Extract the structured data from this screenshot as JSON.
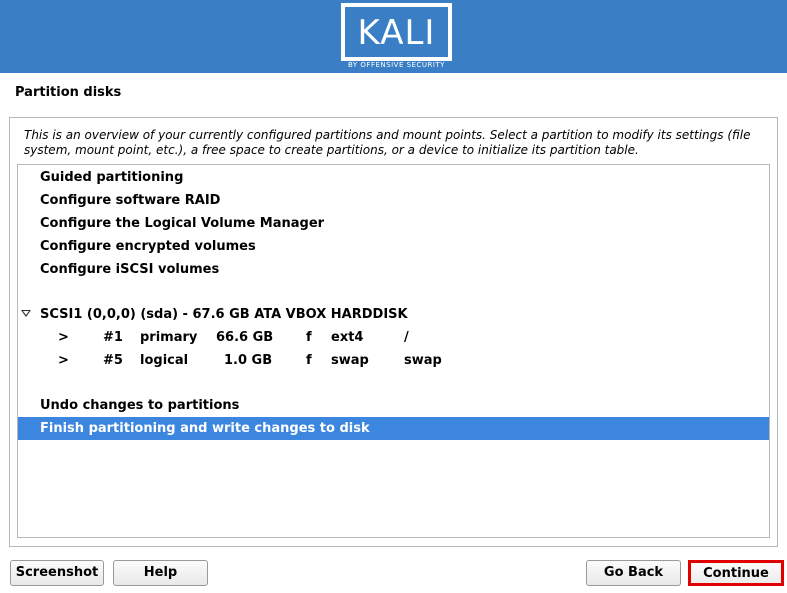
{
  "banner": {
    "logo_text": "KALI",
    "logo_subtitle": "BY OFFENSIVE SECURITY"
  },
  "page": {
    "title": "Partition disks",
    "description": "This is an overview of your currently configured partitions and mount points. Select a partition to modify its settings (file system, mount point, etc.), a free space to create partitions, or a device to initialize its partition table."
  },
  "list": {
    "actions": [
      "Guided partitioning",
      "Configure software RAID",
      "Configure the Logical Volume Manager",
      "Configure encrypted volumes",
      "Configure iSCSI volumes"
    ],
    "disk": {
      "expander_icon": "triangle-down-icon",
      "label": "SCSI1 (0,0,0) (sda) - 67.6 GB ATA VBOX HARDDISK"
    },
    "partitions": [
      {
        "arrow": ">",
        "number": "#1",
        "type": "primary",
        "size": "66.6 GB",
        "flag": "f",
        "fs": "ext4",
        "mount": "/"
      },
      {
        "arrow": ">",
        "number": "#5",
        "type": "logical",
        "size": "1.0 GB",
        "flag": "f",
        "fs": "swap",
        "mount": "swap"
      }
    ],
    "undo": "Undo changes to partitions",
    "finish": "Finish partitioning and write changes to disk",
    "selected_color": "#3c86e0"
  },
  "buttons": {
    "screenshot": "Screenshot",
    "help": "Help",
    "go_back": "Go Back",
    "continue": "Continue",
    "highlight_color": "#e00000"
  },
  "colors": {
    "banner": "#3a7fc6"
  }
}
